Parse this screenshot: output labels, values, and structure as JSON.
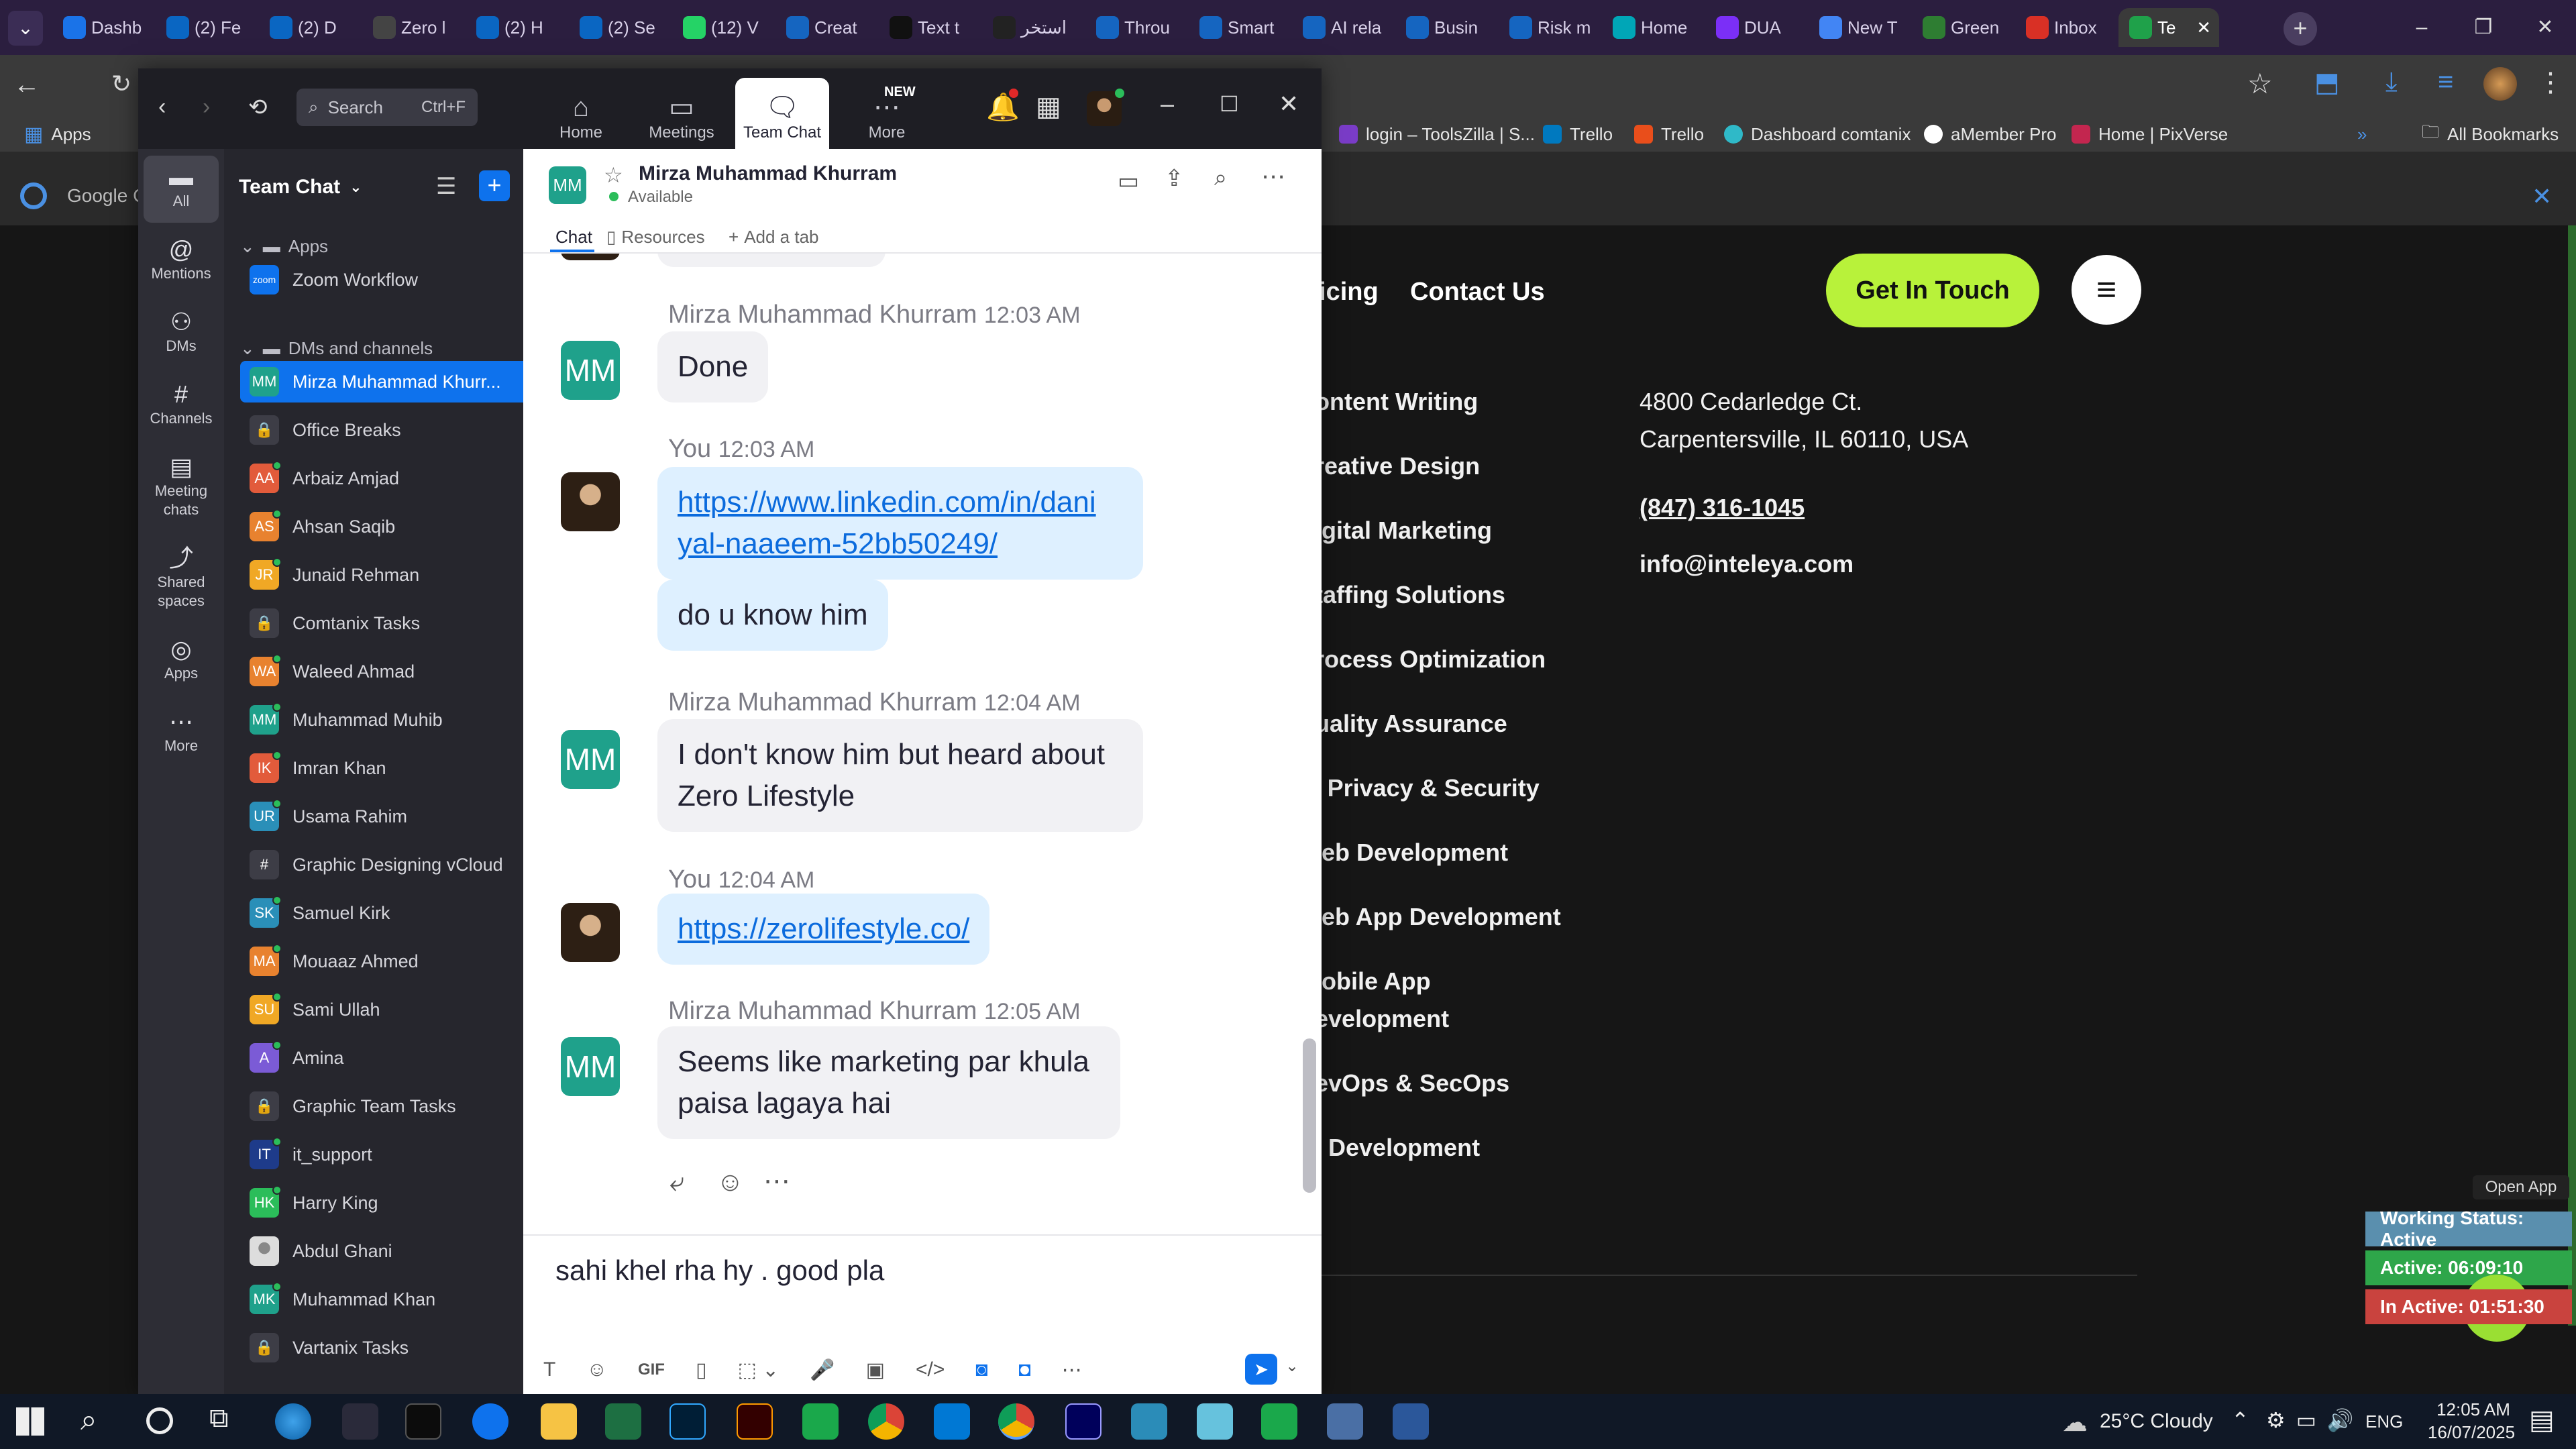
{
  "browser": {
    "tabs": [
      {
        "label": "Dashb",
        "color": "#1a73e8"
      },
      {
        "label": "(2) Fe",
        "color": "#0a66c2"
      },
      {
        "label": "(2) D",
        "color": "#0a66c2"
      },
      {
        "label": "Zero l",
        "color": "#444444"
      },
      {
        "label": "(2) H",
        "color": "#0a66c2"
      },
      {
        "label": "(2) Se",
        "color": "#0a66c2"
      },
      {
        "label": "(12) V",
        "color": "#25d366"
      },
      {
        "label": "Creat",
        "color": "#1565c0"
      },
      {
        "label": "Text t",
        "color": "#111111"
      },
      {
        "label": "استخر",
        "color": "#222222"
      },
      {
        "label": "Throu",
        "color": "#1565c0"
      },
      {
        "label": "Smart",
        "color": "#1565c0"
      },
      {
        "label": "AI rela",
        "color": "#1565c0"
      },
      {
        "label": "Busin",
        "color": "#1565c0"
      },
      {
        "label": "Risk m",
        "color": "#1565c0"
      },
      {
        "label": "Home",
        "color": "#00a6b7"
      },
      {
        "label": "DUA",
        "color": "#7b2ff7"
      },
      {
        "label": "New T",
        "color": "#4285f4"
      },
      {
        "label": "Green",
        "color": "#2e7d32"
      },
      {
        "label": "Inbox",
        "color": "#d93025"
      },
      {
        "label": "Te",
        "color": "#1fa14a"
      }
    ],
    "bookmarks": {
      "apps": "Apps",
      "items": [
        "login – ToolsZilla | S...",
        "Trello",
        "Trello",
        "Dashboard comtanix",
        "aMember Pro",
        "Home | PixVerse"
      ],
      "all": "All Bookmarks"
    },
    "infobar_text": "Google C"
  },
  "website": {
    "nav": {
      "item": "icing",
      "contact": "Contact Us",
      "cta": "Get In Touch"
    },
    "services": [
      "Content Writing",
      "Creative Design",
      "Digital Marketing",
      "Staffing Solutions",
      "Process Optimization",
      "Quality Assurance",
      "IT Privacy & Security",
      "Web Development",
      "Web App Development",
      "Mobile App",
      "Development",
      "DevOps & SecOps",
      "AI Development"
    ],
    "services_shown": [
      "ontent Writing",
      "reative Design",
      "igital Marketing",
      "taffing Solutions",
      "rocess Optimization",
      "uality Assurance",
      "' Privacy & Security",
      "/eb Development",
      "/eb App Development",
      "lobile App",
      "evelopment",
      "evOps & SecOps",
      "I Development"
    ],
    "address1": "4800 Cedarledge Ct.",
    "address2": "Carpentersville, IL 60110, USA",
    "phone": "(847) 316-1045",
    "email": "info@inteleya.com"
  },
  "zoom": {
    "search_placeholder": "Search",
    "search_shortcut": "Ctrl+F",
    "nav": [
      {
        "label": "Home",
        "icon": "home-icon"
      },
      {
        "label": "Meetings",
        "icon": "video-icon"
      },
      {
        "label": "Team Chat",
        "icon": "chat-icon"
      },
      {
        "label": "More",
        "icon": "more-icon",
        "badge": "NEW"
      }
    ],
    "left_rail": [
      {
        "label": "All",
        "icon": "chat-bubble-icon"
      },
      {
        "label": "Mentions",
        "icon": "at-icon"
      },
      {
        "label": "DMs",
        "icon": "people-icon"
      },
      {
        "label": "Channels",
        "icon": "hash-icon"
      },
      {
        "label": "Meeting chats",
        "icon": "calendar-icon"
      },
      {
        "label": "Shared spaces",
        "icon": "share-icon"
      },
      {
        "label": "Apps",
        "icon": "apps-icon"
      },
      {
        "label": "More",
        "icon": "ellipsis-icon"
      }
    ],
    "list_title": "Team Chat",
    "apps_section": "Apps",
    "dms_section": "DMs and channels",
    "apps": [
      {
        "name": "Zoom Workflow",
        "initials": "zoom",
        "color": "#0e72ed"
      }
    ],
    "contacts": [
      {
        "name": "Mirza Muhammad Khurr...",
        "initials": "MM",
        "color": "#1fa18b",
        "selected": true
      },
      {
        "name": "Office Breaks",
        "initials": "",
        "color": "#3d3d46",
        "type": "lock"
      },
      {
        "name": "Arbaiz Amjad",
        "initials": "AA",
        "color": "#e25b3b"
      },
      {
        "name": "Ahsan Saqib",
        "initials": "AS",
        "color": "#e8822f"
      },
      {
        "name": "Junaid Rehman",
        "initials": "JR",
        "color": "#f0a825"
      },
      {
        "name": "Comtanix Tasks",
        "initials": "",
        "color": "#3d3d46",
        "type": "lock"
      },
      {
        "name": "Waleed Ahmad",
        "initials": "WA",
        "color": "#e8822f"
      },
      {
        "name": "Muhammad Muhib",
        "initials": "MM",
        "color": "#1fa18b"
      },
      {
        "name": "Imran Khan",
        "initials": "IK",
        "color": "#e25b3b"
      },
      {
        "name": "Usama Rahim",
        "initials": "UR",
        "color": "#2a8fb8"
      },
      {
        "name": "Graphic Designing vCloud",
        "initials": "#",
        "color": "#3d3d46",
        "type": "hash"
      },
      {
        "name": "Samuel Kirk",
        "initials": "SK",
        "color": "#2a8fb8"
      },
      {
        "name": "Mouaaz Ahmed",
        "initials": "MA",
        "color": "#e8822f"
      },
      {
        "name": "Sami Ullah",
        "initials": "SU",
        "color": "#f0a825"
      },
      {
        "name": "Amina",
        "initials": "A",
        "color": "#7b5bd6"
      },
      {
        "name": "Graphic Team Tasks",
        "initials": "",
        "color": "#3d3d46",
        "type": "lock"
      },
      {
        "name": "it_support",
        "initials": "IT",
        "color": "#1e3b8a"
      },
      {
        "name": "Harry King",
        "initials": "HK",
        "color": "#2bbd5a"
      },
      {
        "name": "Abdul Ghani",
        "initials": "",
        "color": "#dcdcdc",
        "type": "photo"
      },
      {
        "name": "Muhammad Khan",
        "initials": "MK",
        "color": "#1fa18b"
      },
      {
        "name": "Vartanix Tasks",
        "initials": "",
        "color": "#3d3d46",
        "type": "lock"
      }
    ],
    "chat": {
      "contact_name": "Mirza Muhammad Khurram",
      "contact_initials": "MM",
      "status": "Available",
      "tabs": [
        "Chat",
        "Resources",
        "Add a tab"
      ],
      "messages": [
        {
          "sender": "Mirza Muhammad Khurram",
          "time": "12:03 AM",
          "text": "Done",
          "me": false
        },
        {
          "sender": "You",
          "time": "12:03 AM",
          "text": "https://www.linkedin.com/in/daniyal-naaeem-52bb50249/",
          "text_line1": "https://www.linkedin.com/in/dani",
          "text_line2": "yal-naaeem-52bb50249/",
          "me": true,
          "link": true
        },
        {
          "sender": "",
          "time": "",
          "text": "do u know him",
          "me": true
        },
        {
          "sender": "Mirza Muhammad Khurram",
          "time": "12:04 AM",
          "text": "I don't know him but heard about Zero Lifestyle",
          "text_line1": "I don't know him but heard about",
          "text_line2": "Zero Lifestyle",
          "me": false
        },
        {
          "sender": "You",
          "time": "12:04 AM",
          "text": "https://zerolifestyle.co/",
          "me": true,
          "link": true
        },
        {
          "sender": "Mirza Muhammad Khurram",
          "time": "12:05 AM",
          "text": "Seems like marketing par khula paisa lagaya hai",
          "text_line1": "Seems like marketing par khula",
          "text_line2": "paisa lagaya hai",
          "me": false
        }
      ],
      "composer_text": "sahi khel rha hy . good pla"
    }
  },
  "status_widget": {
    "open_app": "Open App",
    "working": "Working Status: Active",
    "active": "Active: 06:09:10",
    "inactive": "In Active: 01:51:30"
  },
  "taskbar": {
    "weather": "25°C  Cloudy",
    "lang": "ENG",
    "time": "12:05 AM",
    "date": "16/07/2025"
  }
}
